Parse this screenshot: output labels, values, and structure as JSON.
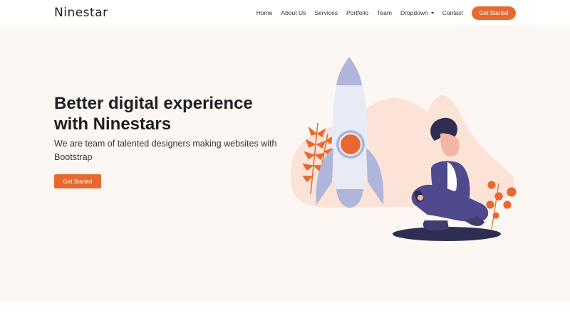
{
  "header": {
    "logo": "Ninestar",
    "nav": [
      {
        "label": "Home"
      },
      {
        "label": "About Us"
      },
      {
        "label": "Services"
      },
      {
        "label": "Portfolio"
      },
      {
        "label": "Team"
      },
      {
        "label": "Dropdown",
        "has_caret": true
      },
      {
        "label": "Contact"
      }
    ],
    "cta": "Get Started"
  },
  "hero": {
    "title": "Better digital experience with Ninestars",
    "subtitle": "We are team of talented designers making websites with Bootstrap",
    "button": "Get Started",
    "illustration_icon": "rocket-and-person-illustration"
  },
  "colors": {
    "accent": "#e8692f",
    "hero_bg": "#fdf7f4",
    "rocket": "#c7cde9",
    "person": "#3f3d6e"
  }
}
